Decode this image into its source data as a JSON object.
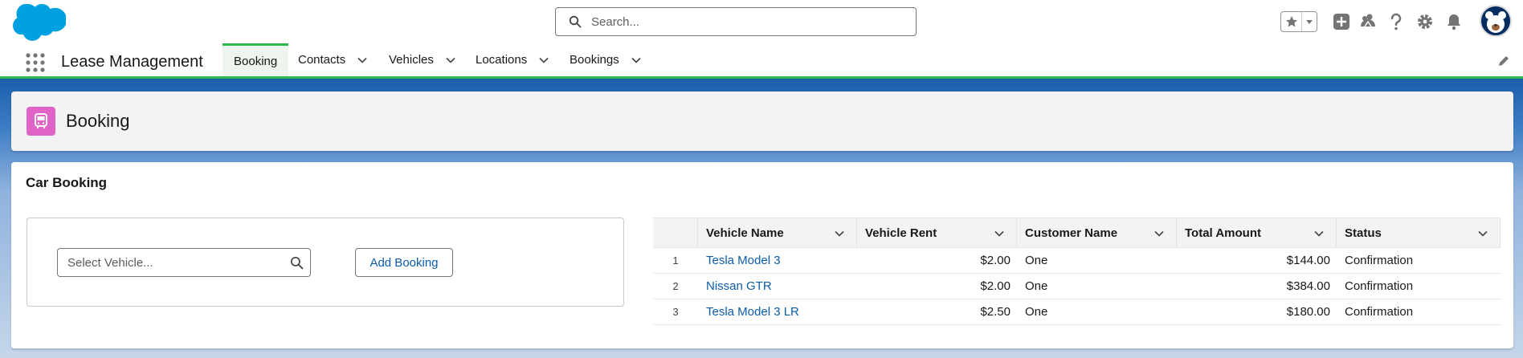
{
  "header": {
    "search_placeholder": "Search...",
    "icons": [
      "salesforce-cloud-logo",
      "search-icon",
      "star-icon",
      "add-icon",
      "trailhead-icon",
      "help-icon",
      "setup-gear-icon",
      "bell-icon",
      "avatar"
    ]
  },
  "nav": {
    "app_name": "Lease Management",
    "tabs": [
      {
        "label": "Booking",
        "active": true
      },
      {
        "label": "Contacts"
      },
      {
        "label": "Vehicles"
      },
      {
        "label": "Locations"
      },
      {
        "label": "Bookings"
      }
    ]
  },
  "page": {
    "title": "Booking",
    "icon_color": "#e063c8"
  },
  "card": {
    "title": "Car Booking",
    "vehicle_placeholder": "Select Vehicle...",
    "add_button": "Add Booking"
  },
  "table": {
    "columns": [
      "Vehicle Name",
      "Vehicle Rent",
      "Customer Name",
      "Total Amount",
      "Status"
    ],
    "rows": [
      {
        "num": "1",
        "vehicle": "Tesla Model 3",
        "rent": "$2.00",
        "customer": "One",
        "total": "$144.00",
        "status": "Confirmation"
      },
      {
        "num": "2",
        "vehicle": "Nissan GTR",
        "rent": "$2.00",
        "customer": "One",
        "total": "$384.00",
        "status": "Confirmation"
      },
      {
        "num": "3",
        "vehicle": "Tesla Model 3 LR",
        "rent": "$2.50",
        "customer": "One",
        "total": "$180.00",
        "status": "Confirmation"
      }
    ]
  },
  "colors": {
    "brand_blue": "#0b5cab",
    "nav_accent": "#2db84d",
    "logo_blue": "#00a1e0"
  }
}
